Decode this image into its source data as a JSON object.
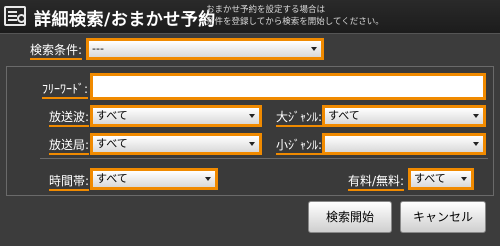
{
  "title": {
    "text": "詳細検索/おまかせ予約",
    "note_line1": "おまかせ予約を設定する場合は",
    "note_line2": "条件を登録してから検索を開始してください。",
    "icon": "search-list-icon"
  },
  "search_condition": {
    "label": "検索条件:",
    "value": "---"
  },
  "free_word": {
    "label": "ﾌﾘｰﾜｰﾄﾞ:",
    "value": ""
  },
  "broadcast_wave": {
    "label": "放送波:",
    "value": "すべて"
  },
  "major_genre": {
    "label": "大ｼﾞｬﾝﾙ:",
    "value": "すべて"
  },
  "station": {
    "label": "放送局:",
    "value": "すべて"
  },
  "minor_genre": {
    "label": "小ｼﾞｬﾝﾙ:",
    "value": ""
  },
  "time_slot": {
    "label": "時間帯:",
    "value": "すべて"
  },
  "paid_free": {
    "label": "有料/無料:",
    "value": "すべて"
  },
  "buttons": {
    "search_start": "検索開始",
    "cancel": "キャンセル"
  },
  "colors": {
    "accent": "#f08a00",
    "background": "#3c3c3c"
  }
}
